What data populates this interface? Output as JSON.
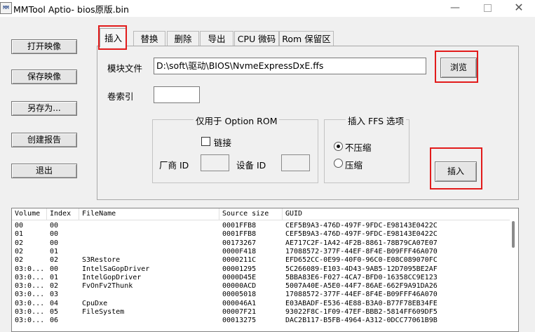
{
  "window": {
    "title": "MMTool Aptio- bios原版.bin",
    "icon_text": "MM"
  },
  "left_buttons": [
    "打开映像",
    "保存映像",
    "另存为...",
    "创建报告",
    "退出"
  ],
  "tabs": [
    "插入",
    "替换",
    "删除",
    "导出",
    "CPU 微码",
    "Rom 保留区"
  ],
  "active_tab": "插入",
  "insert": {
    "module_file_label": "模块文件",
    "module_file_value": "D:\\soft\\驱动\\BIOS\\NvmeExpressDxE.ffs",
    "browse_label": "浏览",
    "volume_index_label": "卷索引",
    "volume_index_value": "",
    "option_rom_group": "仅用于 Option ROM",
    "link_label": "链接",
    "vendor_id_label": "厂商 ID",
    "device_id_label": "设备 ID",
    "ffs_group": "插入 FFS 选项",
    "no_compress_label": "不压缩",
    "compress_label": "压缩",
    "selected_option": "不压缩",
    "insert_button_label": "插入"
  },
  "highlight_color": "#e21b1b",
  "table": {
    "columns": [
      "Volume",
      "Index",
      "FileName",
      "Source size",
      "GUID"
    ],
    "rows": [
      [
        "00",
        "00",
        "",
        "0001FFB8",
        "CEF5B9A3-476D-497F-9FDC-E98143E0422C"
      ],
      [
        "01",
        "00",
        "",
        "0001FFB8",
        "CEF5B9A3-476D-497F-9FDC-E98143E0422C"
      ],
      [
        "02",
        "00",
        "",
        "00173267",
        "AE717C2F-1A42-4F2B-8861-78B79CA07E07"
      ],
      [
        "02",
        "01",
        "",
        "0000F418",
        "17088572-377F-44EF-8F4E-B09FFF46A070"
      ],
      [
        "02",
        "02",
        "S3Restore",
        "0000211C",
        "EFD652CC-0E99-40F0-96C0-E08C089070FC"
      ],
      [
        "03:0...",
        "00",
        "IntelSaGopDriver",
        "00001295",
        "5C266089-E103-4D43-9AB5-12D7095BE2AF"
      ],
      [
        "03:0...",
        "01",
        "IntelGopDriver",
        "0000D45E",
        "5BBA83E6-F027-4CA7-BFD0-16358CC9E123"
      ],
      [
        "03:0...",
        "02",
        "FvOnFv2Thunk",
        "00000ACD",
        "5007A40E-A5E0-44F7-86AE-662F9A91DA26"
      ],
      [
        "03:0...",
        "03",
        "",
        "00005018",
        "17088572-377F-44EF-8F4E-B09FFF46A070"
      ],
      [
        "03:0...",
        "04",
        "CpuDxe",
        "000046A1",
        "E03ABADF-E536-4E88-B3A0-B77F78EB34FE"
      ],
      [
        "03:0...",
        "05",
        "FileSystem",
        "00007F21",
        "93022F8C-1F09-47EF-BBB2-5814FF609DF5"
      ],
      [
        "03:0...",
        "06",
        "",
        "00013275",
        "DAC2B117-B5FB-4964-A312-0DCC77061B9B"
      ]
    ]
  }
}
